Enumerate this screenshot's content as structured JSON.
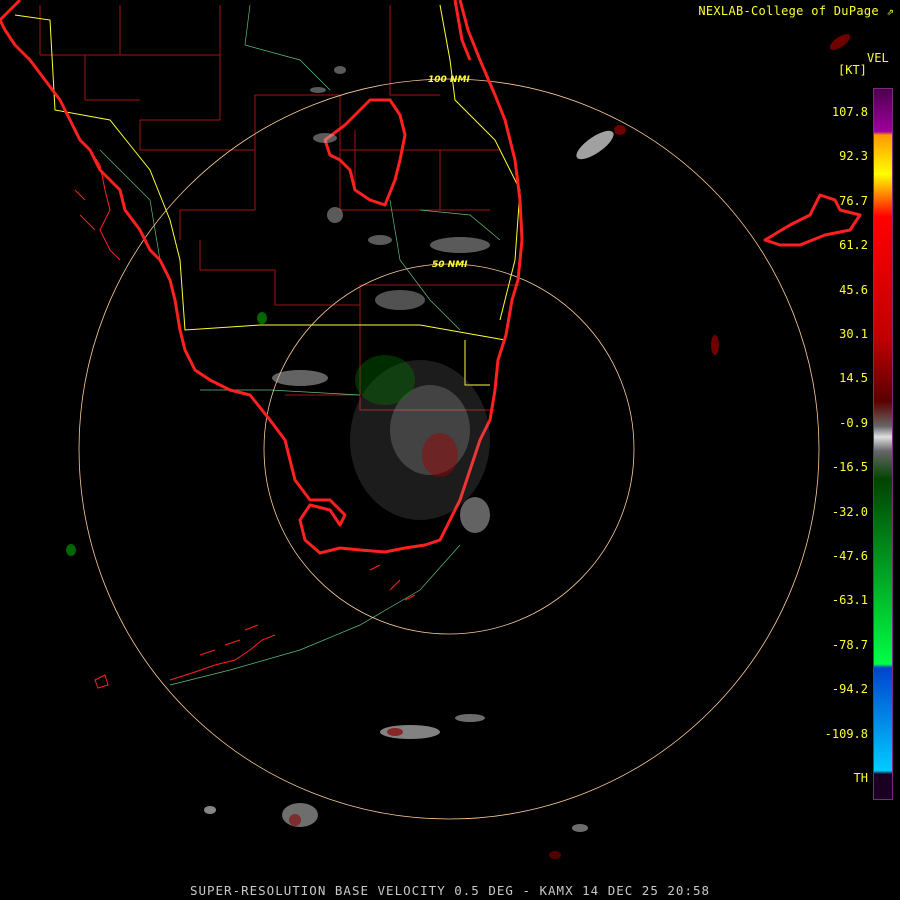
{
  "header": {
    "credit": "NEXLAB-College of DuPage",
    "credit_icon": "external-link-icon"
  },
  "legend": {
    "product": "VEL",
    "units": "[KT]",
    "ticks": [
      "107.8",
      "92.3",
      "76.7",
      "61.2",
      "45.6",
      "30.1",
      "14.5",
      "-0.9",
      "-16.5",
      "-32.0",
      "-47.6",
      "-63.1",
      "-78.7",
      "-94.2",
      "-109.8",
      "TH"
    ],
    "colors": {
      "purple": "#8a008a",
      "yellow": "#ffff00",
      "red": "#ff0000",
      "darkred": "#6a0000",
      "gray": "#b4b4b4",
      "green": "#00ff40",
      "darkgreen": "#006600",
      "blue": "#0044cc",
      "cyan": "#00ccff"
    }
  },
  "map": {
    "ring_labels": [
      "100 NMI",
      "50 NMI"
    ],
    "coastline_color": "#ff2020",
    "county_color": "#b01818",
    "highway_color": "#ffff33",
    "ring_color": "#ffcc99"
  },
  "footer": {
    "caption": "SUPER-RESOLUTION BASE VELOCITY 0.5 DEG - KAMX 14 DEC 25 20:58"
  }
}
